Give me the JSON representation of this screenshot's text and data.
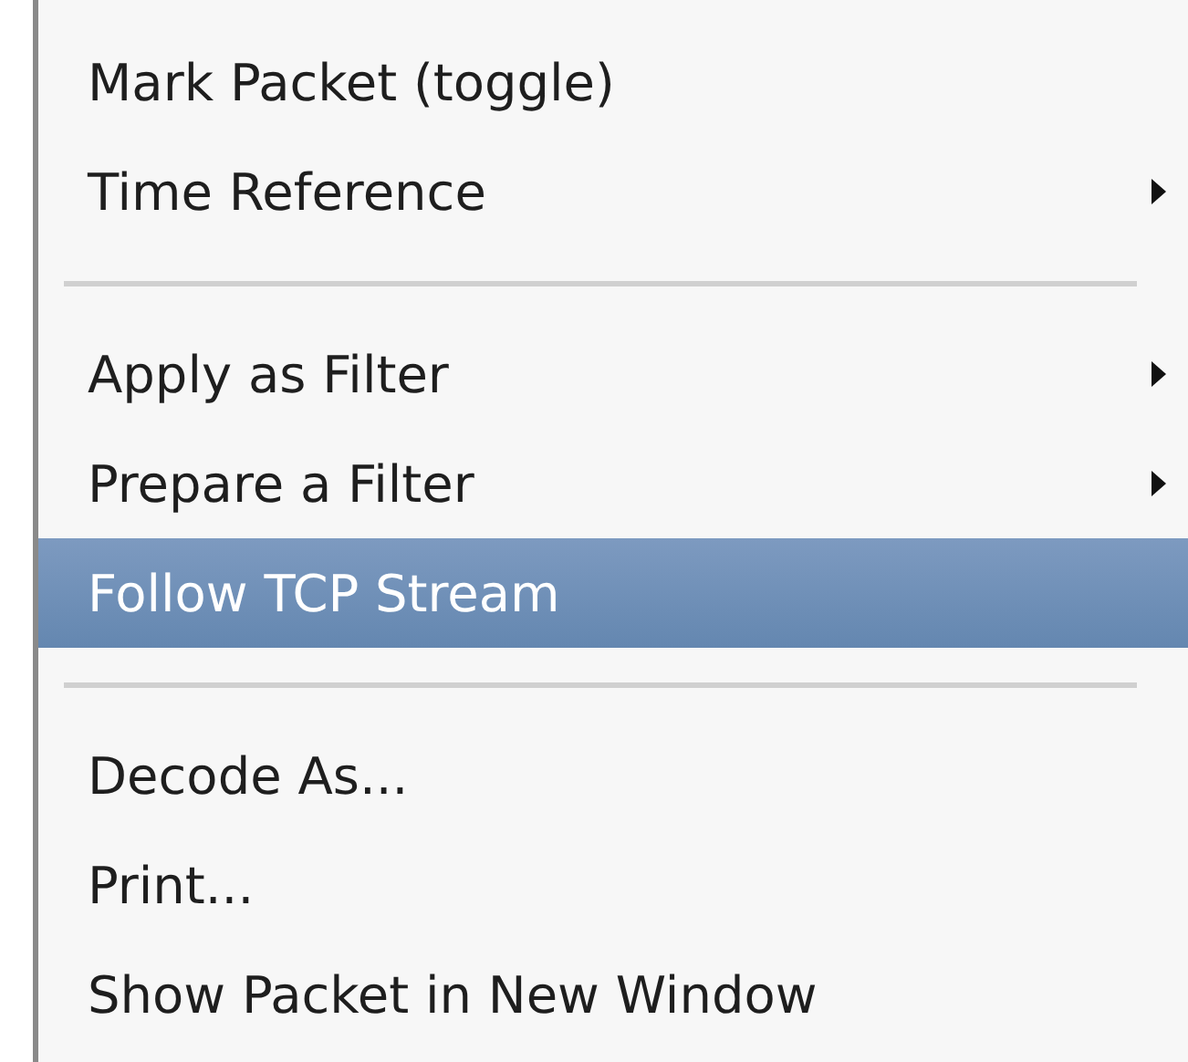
{
  "menu": {
    "items": [
      {
        "kind": "item",
        "label": "Mark Packet (toggle)",
        "submenu": false,
        "selected": false
      },
      {
        "kind": "item",
        "label": "Time Reference",
        "submenu": true,
        "selected": false
      },
      {
        "kind": "separator"
      },
      {
        "kind": "item",
        "label": "Apply as Filter",
        "submenu": true,
        "selected": false
      },
      {
        "kind": "item",
        "label": "Prepare a Filter",
        "submenu": true,
        "selected": false
      },
      {
        "kind": "item",
        "label": "Follow TCP Stream",
        "submenu": false,
        "selected": true
      },
      {
        "kind": "separator"
      },
      {
        "kind": "item",
        "label": "Decode As...",
        "submenu": false,
        "selected": false
      },
      {
        "kind": "item",
        "label": "Print...",
        "submenu": false,
        "selected": false
      },
      {
        "kind": "item",
        "label": "Show Packet in New Window",
        "submenu": false,
        "selected": false
      }
    ]
  }
}
